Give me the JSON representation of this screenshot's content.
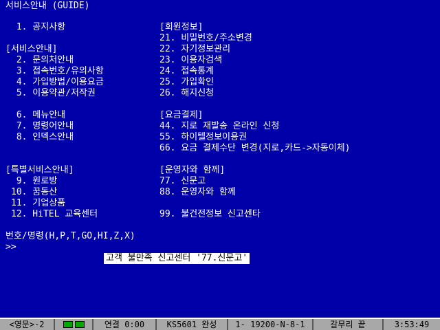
{
  "header": {
    "title": "서비스안내 (GUIDE)"
  },
  "left_column": {
    "item1": " 1. 공지사항",
    "section1": "[서비스안내]",
    "item2": " 2. 문의처안내",
    "item3": " 3. 접속번호/유의사항",
    "item4": " 4. 가입방법/이용요금",
    "item5": " 5. 이용약관/저작권",
    "item6": " 6. 메뉴안내",
    "item7": " 7. 명령어안내",
    "item8": " 8. 인덱스안내",
    "section2": "[특별서비스안내]",
    "item9": " 9. 원로방",
    "item10": "10. 꿈동산",
    "item11": "11. 기업상품",
    "item12": "12. HiTEL 교육센터"
  },
  "right_column": {
    "section1": "[회원정보]",
    "item21": "21. 비밀번호/주소변경",
    "item22": "22. 자기정보관리",
    "item23": "23. 이용자검색",
    "item24": "24. 접속통계",
    "item25": "25. 가입확인",
    "item26": "26. 해지신청",
    "section2": "[요금결제]",
    "item44": "44. 지로 재발송 온라인 신청",
    "item55": "55. 하이텔정보이용권",
    "item66": "66. 요금 결제수단 변경(지로,카드->자동이체)",
    "section3": "[운영자와 함께]",
    "item77": "77. 신문고",
    "item88": "88. 운영자와 함께",
    "item99": "99. 불건전정보 신고센타"
  },
  "prompt": {
    "commands": "번호/명령(H,P,T,GO,HI,Z,X)",
    "cursor": ">>"
  },
  "notice": {
    "text": "고객 불만족 신고센터 '77.신문고'"
  },
  "statusbar": {
    "mode": "<영문>-2",
    "connection": "연결 0:00",
    "encoding": "KS5601 완성",
    "port": "1- 19200-N-8-1",
    "end": "갈무리 끝",
    "clock": "3:53:49"
  },
  "colors": {
    "background": "#0000a8",
    "text": "#ffffff",
    "statusbar": "#a8a8a8",
    "led": "#00a800"
  }
}
